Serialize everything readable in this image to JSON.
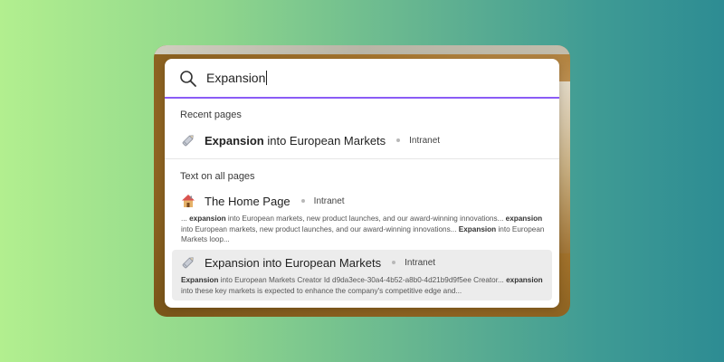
{
  "search": {
    "query": "Expansion"
  },
  "sections": {
    "recent_title": "Recent pages",
    "text_title": "Text on all pages"
  },
  "recent": [
    {
      "icon": "pencil-icon",
      "title_bold": "Expansion",
      "title_rest": " into European Markets",
      "site": "Intranet"
    }
  ],
  "text_results": [
    {
      "icon": "house-icon",
      "title": "The Home Page",
      "site": "Intranet",
      "snippet": [
        {
          "t": "... ",
          "b": false
        },
        {
          "t": "expansion",
          "b": true
        },
        {
          "t": " into European markets, new product launches, and our award-winning innovations... ",
          "b": false
        },
        {
          "t": "expansion",
          "b": true
        },
        {
          "t": " into European markets, new product launches, and our award-winning innovations... ",
          "b": false
        },
        {
          "t": "Expansion",
          "b": true
        },
        {
          "t": " into European Markets loop...",
          "b": false
        }
      ]
    },
    {
      "icon": "pencil-icon",
      "title": "Expansion into European Markets",
      "site": "Intranet",
      "selected": true,
      "snippet": [
        {
          "t": "Expansion",
          "b": true
        },
        {
          "t": " into European Markets Creator Id d9da3ece-30a4-4b52-a8b0-4d21b9d9f5ee Creator... ",
          "b": false
        },
        {
          "t": "expansion",
          "b": true
        },
        {
          "t": " into these key markets is expected to enhance the company's competitive edge and...",
          "b": false
        }
      ]
    }
  ],
  "colors": {
    "accent": "#8b5cf6",
    "selected_bg": "#ececec"
  }
}
